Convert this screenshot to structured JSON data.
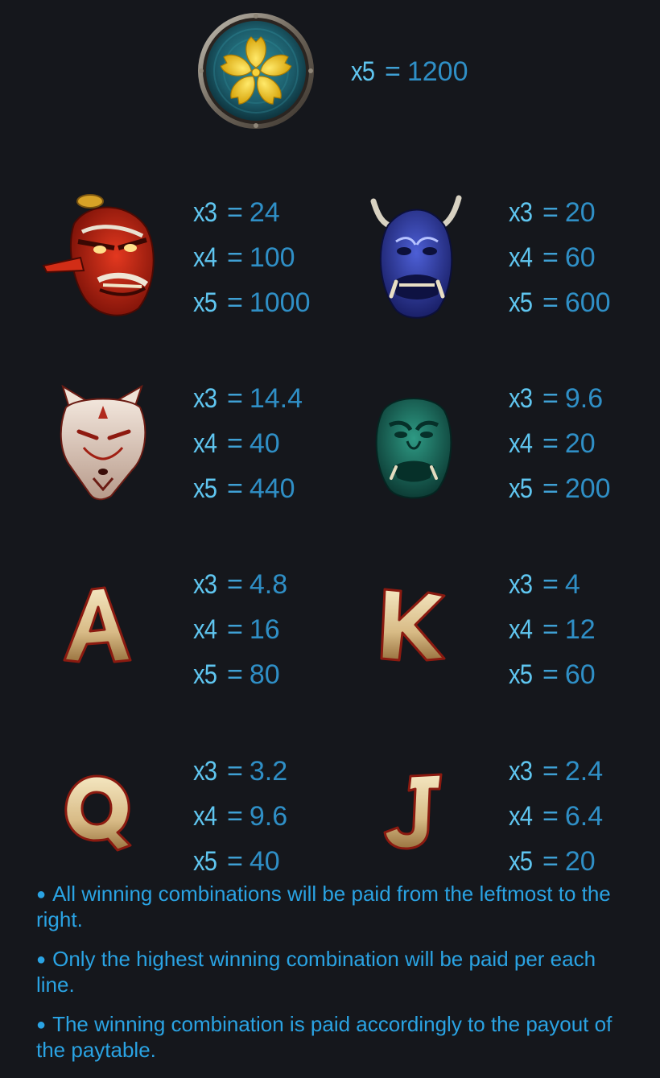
{
  "top_symbol": {
    "icon": "sakura-coin-icon",
    "mult": "x5",
    "eq": "=",
    "value": "1200"
  },
  "symbols": [
    {
      "icon": "red-tengu-mask-icon",
      "pays": [
        {
          "mult": "x3",
          "eq": "=",
          "value": "24"
        },
        {
          "mult": "x4",
          "eq": "=",
          "value": "100"
        },
        {
          "mult": "x5",
          "eq": "=",
          "value": "1000"
        }
      ]
    },
    {
      "icon": "blue-oni-mask-icon",
      "pays": [
        {
          "mult": "x3",
          "eq": "=",
          "value": "20"
        },
        {
          "mult": "x4",
          "eq": "=",
          "value": "60"
        },
        {
          "mult": "x5",
          "eq": "=",
          "value": "600"
        }
      ]
    },
    {
      "icon": "kitsune-fox-mask-icon",
      "pays": [
        {
          "mult": "x3",
          "eq": "=",
          "value": "14.4"
        },
        {
          "mult": "x4",
          "eq": "=",
          "value": "40"
        },
        {
          "mult": "x5",
          "eq": "=",
          "value": "440"
        }
      ]
    },
    {
      "icon": "green-oni-mask-icon",
      "pays": [
        {
          "mult": "x3",
          "eq": "=",
          "value": "9.6"
        },
        {
          "mult": "x4",
          "eq": "=",
          "value": "20"
        },
        {
          "mult": "x5",
          "eq": "=",
          "value": "200"
        }
      ]
    },
    {
      "icon": "letter-a-icon",
      "pays": [
        {
          "mult": "x3",
          "eq": "=",
          "value": "4.8"
        },
        {
          "mult": "x4",
          "eq": "=",
          "value": "16"
        },
        {
          "mult": "x5",
          "eq": "=",
          "value": "80"
        }
      ]
    },
    {
      "icon": "letter-k-icon",
      "pays": [
        {
          "mult": "x3",
          "eq": "=",
          "value": "4"
        },
        {
          "mult": "x4",
          "eq": "=",
          "value": "12"
        },
        {
          "mult": "x5",
          "eq": "=",
          "value": "60"
        }
      ]
    },
    {
      "icon": "letter-q-icon",
      "pays": [
        {
          "mult": "x3",
          "eq": "=",
          "value": "3.2"
        },
        {
          "mult": "x4",
          "eq": "=",
          "value": "9.6"
        },
        {
          "mult": "x5",
          "eq": "=",
          "value": "40"
        }
      ]
    },
    {
      "icon": "letter-j-icon",
      "pays": [
        {
          "mult": "x3",
          "eq": "=",
          "value": "2.4"
        },
        {
          "mult": "x4",
          "eq": "=",
          "value": "6.4"
        },
        {
          "mult": "x5",
          "eq": "=",
          "value": "20"
        }
      ]
    }
  ],
  "rules": [
    {
      "bullet": "●",
      "text": "All winning combinations will be paid from the leftmost to the right."
    },
    {
      "bullet": "●",
      "text": "Only the highest winning combination will be paid per each line."
    },
    {
      "bullet": "●",
      "text": "The winning combination is paid accordingly to the payout of the paytable."
    }
  ],
  "colors": {
    "background": "#15171c",
    "multiplier": "#5fc5ef",
    "value": "#2f8fc6",
    "rules_text": "#2aa3e3"
  }
}
